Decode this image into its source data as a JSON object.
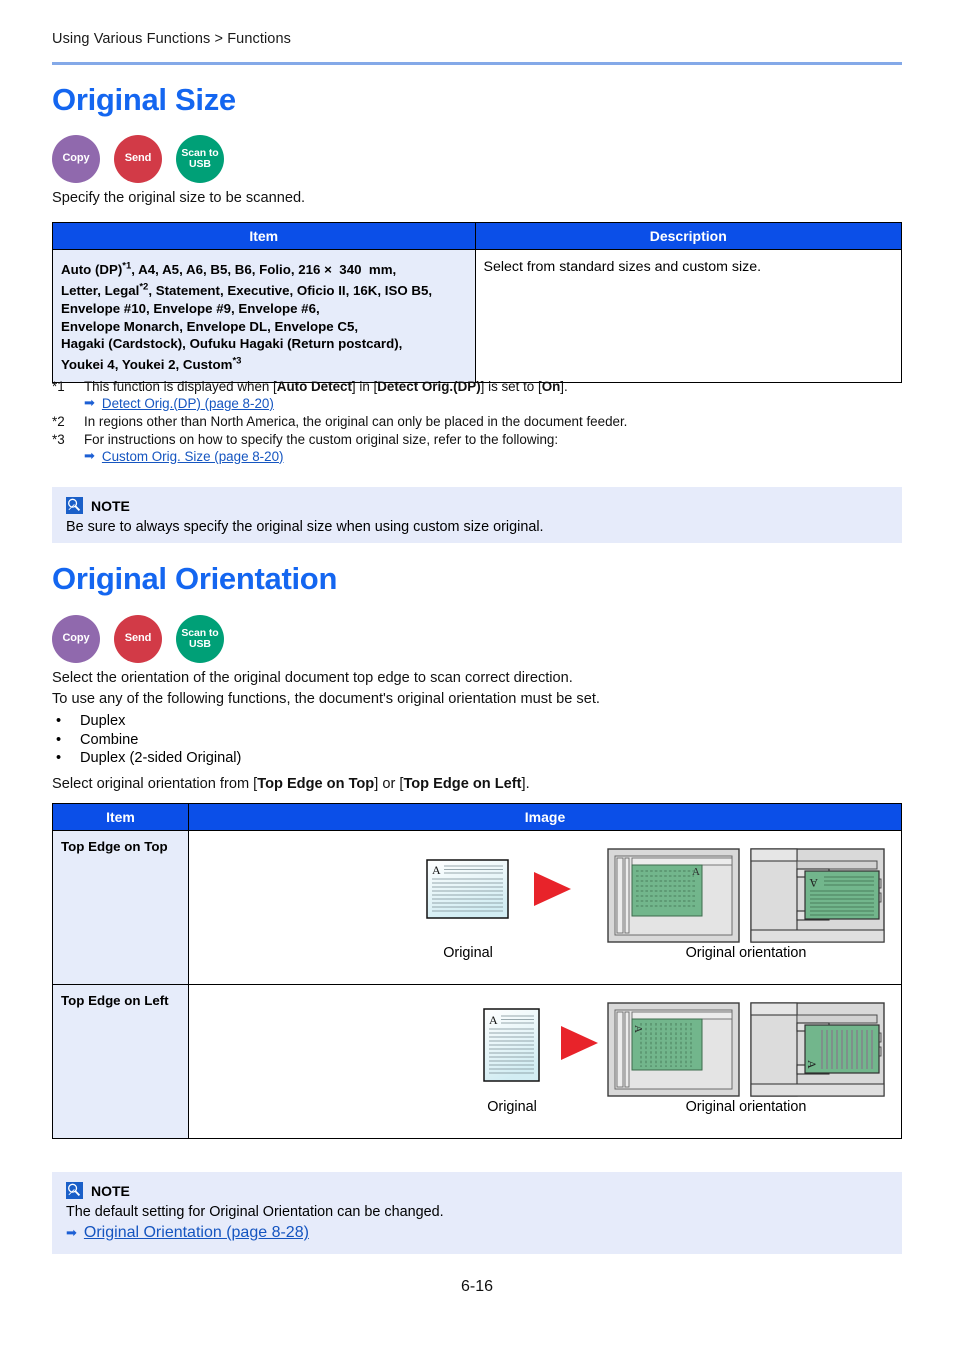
{
  "breadcrumb": "Using Various Functions > Functions",
  "page_number": "6-16",
  "colors": {
    "heading_blue": "#1466f0",
    "rule_blue": "#84a9e8",
    "table_header_blue": "#0b4fe8",
    "item_cell_blue": "#e6ecfa",
    "note_bg": "#e6ebfa",
    "link_blue": "#1555c0",
    "badge_copy": "#9069ad",
    "badge_send": "#d23a47",
    "badge_scan": "#00a077",
    "arrow_red": "#e8232a",
    "paper_green": "#72b68c"
  },
  "badges": [
    {
      "name": "copy",
      "label": "Copy",
      "class": "copy"
    },
    {
      "name": "send",
      "label": "Send",
      "class": "send"
    },
    {
      "name": "scan-to-usb",
      "label_line1": "Scan to",
      "label_line2": "USB",
      "class": "scan"
    }
  ],
  "section_original_size": {
    "heading": "Original Size",
    "intro": "Specify the original size to be scanned.",
    "table": {
      "headers": [
        "Item",
        "Description"
      ],
      "rows": [
        {
          "item_lines": [
            "Auto (DP)*1, A4, A5, A6, B5, B6, Folio, 216 ×  340  mm,",
            "Letter, Legal*2, Statement, Executive, Oficio II, 16K, ISO B5,",
            "Envelope #10, Envelope #9, Envelope #6,",
            "Envelope Monarch, Envelope DL, Envelope C5,",
            "Hagaki (Cardstock), Oufuku Hagaki (Return postcard),",
            "Youkei 4, Youkei 2, Custom*3"
          ],
          "description": "Select from standard sizes and custom size."
        }
      ]
    },
    "footnotes": [
      {
        "mark": "*1",
        "text_parts": [
          "This function is displayed when [",
          "Auto Detect",
          "] in [",
          "Detect Orig.(DP)",
          "] is set to [",
          "On",
          "]."
        ],
        "link": "Detect Orig.(DP) (page 8-20)"
      },
      {
        "mark": "*2",
        "plain": "In regions other than North America, the original can only be placed in the document feeder.",
        "link": null
      },
      {
        "mark": "*3",
        "plain": "For instructions on how to specify the custom original size, refer to the following:",
        "link": "Custom Orig. Size (page 8-20)"
      }
    ],
    "note": {
      "title": "NOTE",
      "body": "Be sure to always specify the original size when using custom size original."
    }
  },
  "section_original_orientation": {
    "heading": "Original Orientation",
    "intro_line1": "Select the orientation of the original document top edge to scan correct direction.",
    "intro_line2": "To use any of the following functions, the document's original orientation must be set.",
    "bullets": [
      "Duplex",
      "Combine",
      "Duplex (2-sided Original)"
    ],
    "select_line": {
      "prefix": "Select original orientation from [",
      "option1": "Top Edge on Top",
      "middle": "] or [",
      "option2": "Top Edge on Left",
      "suffix": "]."
    },
    "table": {
      "headers": [
        "Item",
        "Image"
      ],
      "rows": [
        {
          "item": "Top Edge on Top",
          "caption_left": "Original",
          "caption_right": "Original orientation",
          "doc_letter": "A",
          "doc_shape": "landscape"
        },
        {
          "item": "Top Edge on Left",
          "caption_left": "Original",
          "caption_right": "Original orientation",
          "doc_letter": "A",
          "doc_shape": "portrait"
        }
      ]
    },
    "note": {
      "title": "NOTE",
      "body": "The default setting for Original Orientation can be changed.",
      "link": "Original Orientation (page 8-28)"
    }
  }
}
